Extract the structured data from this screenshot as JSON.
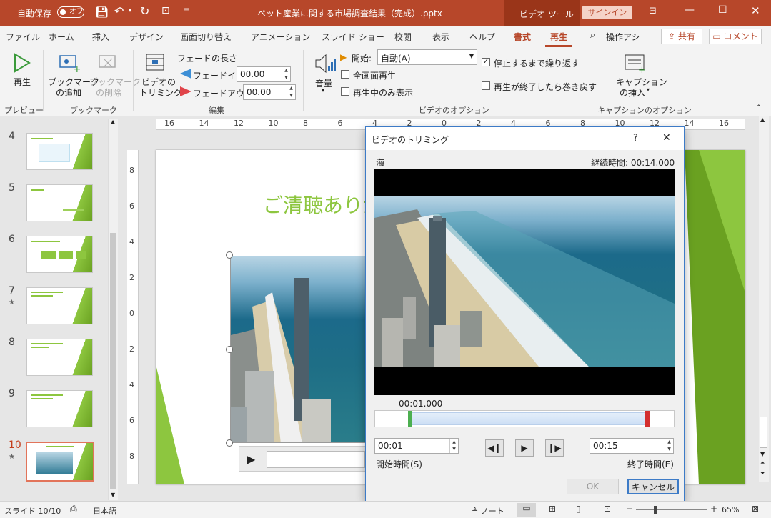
{
  "titlebar": {
    "autosave_label": "自動保存",
    "autosave_state": "オフ",
    "doc_title": "ペット産業に関する市場調査結果（完成）.pptx",
    "context_tool": "ビデオ ツール",
    "signin": "サインイン"
  },
  "tabs": {
    "items": [
      "ファイル",
      "ホーム",
      "挿入",
      "デザイン",
      "画面切り替え",
      "アニメーション",
      "スライド ショー",
      "校閲",
      "表示",
      "ヘルプ",
      "書式",
      "再生"
    ],
    "search": "操作アシ",
    "share": "共有",
    "comments": "コメント"
  },
  "ribbon": {
    "preview": {
      "play": "再生",
      "group": "プレビュー"
    },
    "bookmark": {
      "add1": "ブックマーク",
      "add2": "の追加",
      "del1": "ブックマーク",
      "del2": "の削除",
      "group": "ブックマーク"
    },
    "edit": {
      "trim1": "ビデオの",
      "trim2": "トリミング",
      "fade_title": "フェードの長さ",
      "fade_in": "フェードイン:",
      "fade_in_val": "00.00",
      "fade_out": "フェードアウト:",
      "fade_out_val": "00.00",
      "group": "編集"
    },
    "options": {
      "volume": "音量",
      "start_label": "開始:",
      "start_val": "自動(A)",
      "fullscreen": "全画面再生",
      "hide": "再生中のみ表示",
      "loop": "停止するまで繰り返す",
      "rewind": "再生が終了したら巻き戻す",
      "group": "ビデオのオプション"
    },
    "caption": {
      "insert1": "キャプション",
      "insert2": "の挿入",
      "group": "キャプションのオプション"
    }
  },
  "thumbs": [
    {
      "num": "4",
      "star": ""
    },
    {
      "num": "5",
      "star": ""
    },
    {
      "num": "6",
      "star": ""
    },
    {
      "num": "7",
      "star": "★"
    },
    {
      "num": "8",
      "star": ""
    },
    {
      "num": "9",
      "star": ""
    },
    {
      "num": "10",
      "star": "★"
    }
  ],
  "slide": {
    "title": "ご清聴ありが"
  },
  "ruler": {
    "top": [
      "16",
      "14",
      "12",
      "10",
      "8",
      "6",
      "4",
      "2",
      "0",
      "2",
      "4",
      "6",
      "8",
      "10",
      "12",
      "14",
      "16"
    ],
    "left": [
      "8",
      "6",
      "4",
      "2",
      "0",
      "2",
      "4",
      "6",
      "8"
    ]
  },
  "dialog": {
    "title": "ビデオのトリミング",
    "help": "?",
    "close": "✕",
    "video_name": "海",
    "duration": "継続時間: 00:14.000",
    "current_time": "00:01.000",
    "start_val": "00:01",
    "end_val": "00:15",
    "start_label": "開始時間(S)",
    "end_label": "終了時間(E)",
    "ok": "OK",
    "cancel": "キャンセル",
    "trim_start": 0.0714,
    "trim_end": 1.0
  },
  "status": {
    "slide": "スライド 10/10",
    "lang": "日本語",
    "notes": "ノート",
    "zoom": "65%"
  }
}
